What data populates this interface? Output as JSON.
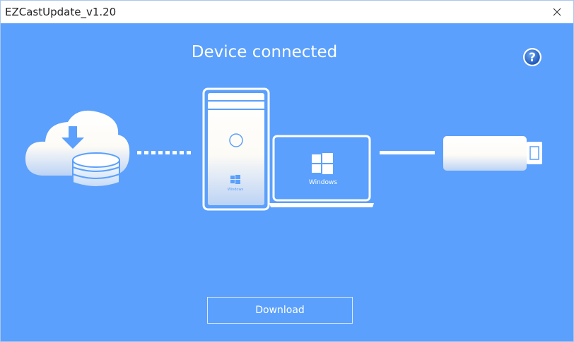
{
  "window": {
    "title": "EZCastUpdate_v1.20"
  },
  "main": {
    "heading": "Device connected",
    "download_label": "Download"
  },
  "illustration": {
    "tower_logo_text": "Windows",
    "laptop_logo_text": "Windows"
  },
  "icons": {
    "close": "close-icon",
    "help": "help-icon",
    "cloud": "cloud-download-icon",
    "database": "database-icon",
    "tower": "desktop-tower-icon",
    "laptop": "laptop-icon",
    "dongle": "usb-dongle-icon"
  },
  "colors": {
    "background": "#5ba0fc",
    "accent_white": "#ffffff",
    "help_blue": "#1f5fc2"
  }
}
